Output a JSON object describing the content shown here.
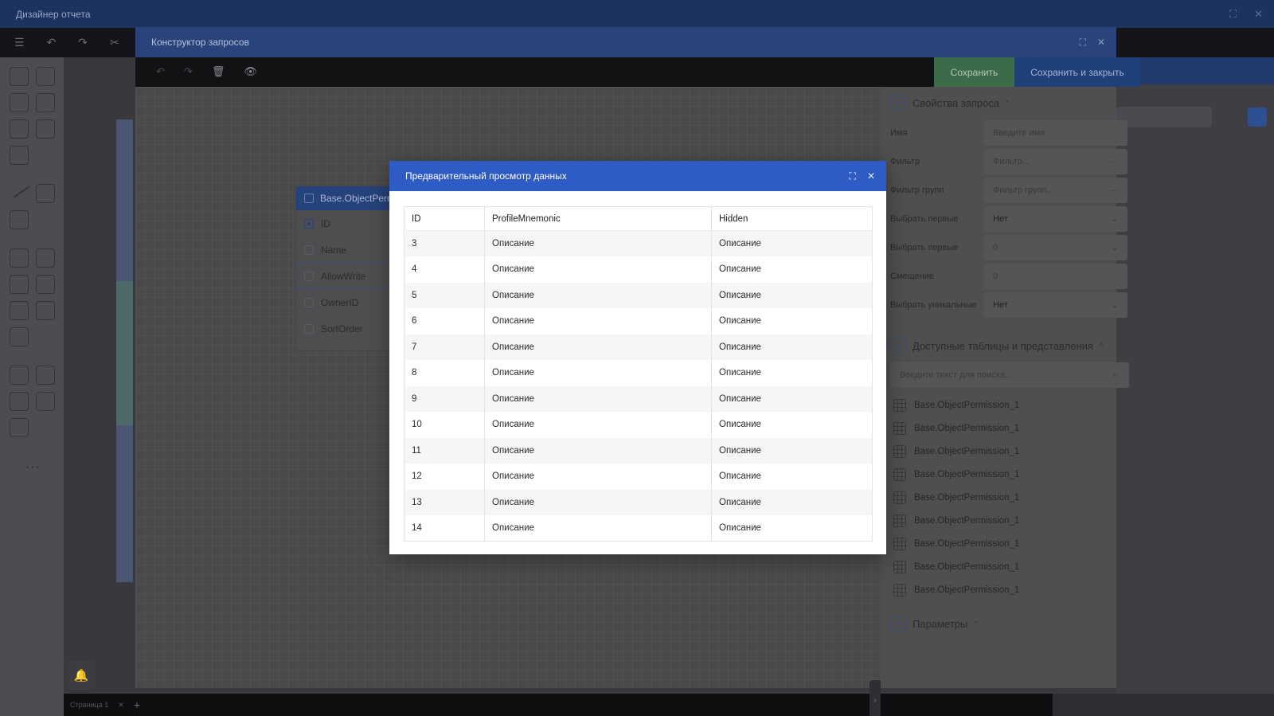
{
  "app": {
    "title": "Дизайнер отчета",
    "page_tab": "Страница 1"
  },
  "query_builder": {
    "title": "Конструктор запросов",
    "save_label": "Сохранить",
    "save_close_label": "Сохранить и закрыть",
    "table_card": {
      "title": "Base.ObjectPerm",
      "fields": [
        "ID",
        "Name",
        "AllowWrite",
        "OwnerID",
        "SortOrder"
      ]
    }
  },
  "properties": {
    "section_title": "Свойства запроса",
    "rows": [
      {
        "label": "Имя",
        "value": "Введите имя",
        "placeholder": true,
        "tail": ""
      },
      {
        "label": "Фильтр",
        "value": "Фильтр...",
        "placeholder": true,
        "tail": "···"
      },
      {
        "label": "Фильтр групп",
        "value": "Фильтр групп...",
        "placeholder": true,
        "tail": "···"
      },
      {
        "label": "Выбрать первые",
        "value": "Нет",
        "placeholder": false,
        "tail": "⌄"
      },
      {
        "label": "Выбрать первые",
        "value": "0",
        "placeholder": true,
        "tail": "⌄"
      },
      {
        "label": "Смещение",
        "value": "0",
        "placeholder": true,
        "tail": ""
      },
      {
        "label": "Выбрать уникальные",
        "value": "Нет",
        "placeholder": false,
        "tail": "⌄"
      }
    ],
    "tables_title": "Доступные таблицы и представления",
    "tables_search_placeholder": "Введите текст для поиска...",
    "tables": [
      "Base.ObjectPermission_1",
      "Base.ObjectPermission_1",
      "Base.ObjectPermission_1",
      "Base.ObjectPermission_1",
      "Base.ObjectPermission_1",
      "Base.ObjectPermission_1",
      "Base.ObjectPermission_1",
      "Base.ObjectPermission_1",
      "Base.ObjectPermission_1"
    ],
    "params_title": "Параметры"
  },
  "preview": {
    "title": "Предварительный просмотр данных",
    "columns": [
      "ID",
      "ProfileMnemonic",
      "Hidden"
    ],
    "rows": [
      [
        "3",
        "Описание",
        "Описание"
      ],
      [
        "4",
        "Описание",
        "Описание"
      ],
      [
        "5",
        "Описание",
        "Описание"
      ],
      [
        "6",
        "Описание",
        "Описание"
      ],
      [
        "7",
        "Описание",
        "Описание"
      ],
      [
        "8",
        "Описание",
        "Описание"
      ],
      [
        "9",
        "Описание",
        "Описание"
      ],
      [
        "10",
        "Описание",
        "Описание"
      ],
      [
        "11",
        "Описание",
        "Описание"
      ],
      [
        "12",
        "Описание",
        "Описание"
      ],
      [
        "13",
        "Описание",
        "Описание"
      ],
      [
        "14",
        "Описание",
        "Описание"
      ]
    ]
  },
  "colors": {
    "accent": "#2f5bc4",
    "save": "#3b6b48",
    "titlebar": "#1d335f"
  },
  "icons": [
    "menu-icon",
    "undo-icon",
    "redo-icon",
    "scissors-icon",
    "trash-icon",
    "eye-icon",
    "maximize-icon",
    "close-icon",
    "search-icon",
    "bell-icon",
    "grid-table-icon"
  ]
}
